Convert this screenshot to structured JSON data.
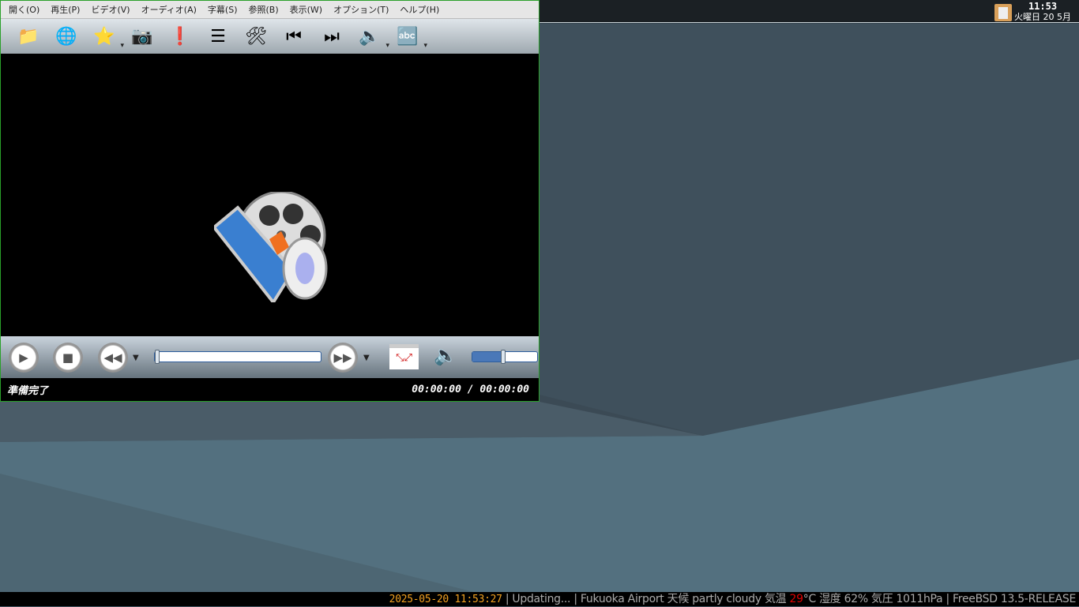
{
  "menu": [
    "開く(O)",
    "再生(P)",
    "ビデオ(V)",
    "オーディオ(A)",
    "字幕(S)",
    "参照(B)",
    "表示(W)",
    "オプション(T)",
    "ヘルプ(H)"
  ],
  "toolbar": [
    {
      "icon": "folder-icon",
      "glyph": "📁"
    },
    {
      "icon": "globe-icon",
      "glyph": "🌐"
    },
    {
      "icon": "favorites-star-icon",
      "glyph": "⭐",
      "dropdown": true
    },
    {
      "icon": "screenshot-camera-icon",
      "glyph": "📷"
    },
    {
      "icon": "info-icon",
      "glyph": "❗"
    },
    {
      "icon": "playlist-icon",
      "glyph": "☰"
    },
    {
      "icon": "preferences-tools-icon",
      "glyph": "🛠"
    },
    {
      "icon": "previous-track-icon",
      "glyph": "⏮"
    },
    {
      "icon": "next-track-icon",
      "glyph": "⏭"
    },
    {
      "icon": "audio-speaker-icon",
      "glyph": "🔈",
      "dropdown": true
    },
    {
      "icon": "subtitles-abc-icon",
      "glyph": "🔤",
      "dropdown": true
    }
  ],
  "player": {
    "status": "準備完了",
    "time": "00:00:00 / 00:00:00",
    "seek_fraction": 0,
    "volume_fraction": 0.5
  },
  "panel": {
    "clock_time": "11:53",
    "clock_date": "火曜日 20 5月"
  },
  "bottombar": {
    "datetime": "2025-05-20 11:53:27",
    "part1": " | Updating... | Fukuoka Airport 天候  partly cloudy  気温 ",
    "temp": "29",
    "part2": "°C 湿度 62% 気圧 1011hPa | FreeBSD 13.5-RELEASE"
  },
  "colors": {
    "accent": "#2aa02a",
    "datetime": "#f0a020",
    "temp": "#e00000"
  }
}
